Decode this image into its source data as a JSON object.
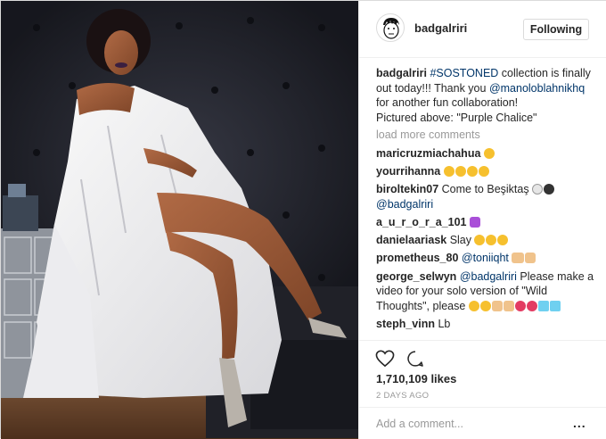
{
  "post": {
    "username": "badgalriri",
    "follow_label": "Following",
    "caption": {
      "username": "badgalriri",
      "hashtag": "#SOSTONED",
      "text_1": " collection is finally out today!!! Thank you ",
      "mention": "@manoloblahnikhq",
      "text_2": " for another fun collaboration!",
      "text_3": "Pictured above: \"Purple Chalice\""
    },
    "load_more": "load more comments",
    "comments": [
      {
        "user": "maricruzmiachahua",
        "text": ""
      },
      {
        "user": "yourrihanna",
        "text": ""
      },
      {
        "user": "biroltekin07",
        "text": " Come to Beşiktaş ",
        "mention": "@badgalriri"
      },
      {
        "user": "a_u_r_o_r_a_101",
        "text": ""
      },
      {
        "user": "danielaariask",
        "text": " Slay "
      },
      {
        "user": "prometheus_80",
        "text": " ",
        "mention": "@toniiqht"
      },
      {
        "user": "george_selwyn",
        "mention": "@badgalriri",
        "text": " Please make a video for your solo version of \"Wild Thoughts\", please "
      },
      {
        "user": "steph_vinn",
        "text": " Lb"
      }
    ],
    "likes": "1,710,109 likes",
    "date": "2 DAYS AGO",
    "add_comment_placeholder": "Add a comment...",
    "more_label": "..."
  },
  "icons": {
    "avatar": "avatar-icon",
    "like": "heart-icon",
    "comment": "comment-icon",
    "more": "more-options-icon"
  },
  "colors": {
    "link": "#003569",
    "muted": "#999999",
    "text": "#262626",
    "photo_background": "#1b1c24"
  }
}
